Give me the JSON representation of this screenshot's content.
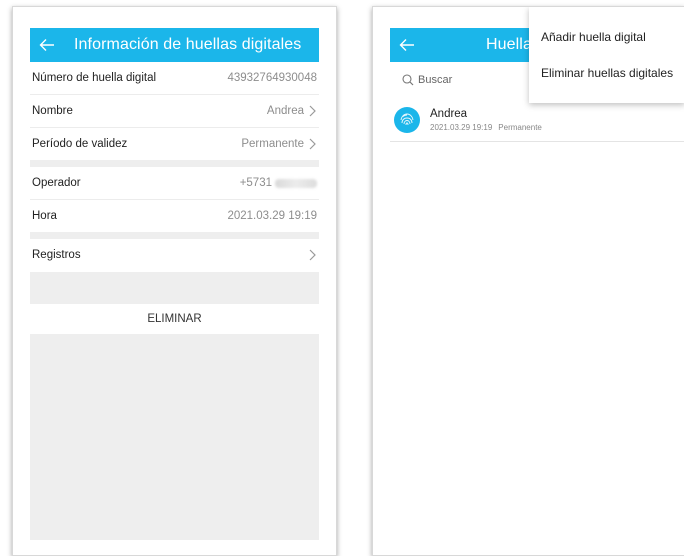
{
  "left": {
    "title": "Información de huellas digitales",
    "rows": [
      {
        "label": "Número de huella digital",
        "value": "43932764930048"
      },
      {
        "label": "Nombre",
        "value": "Andrea"
      },
      {
        "label": "Período de validez",
        "value": "Permanente"
      },
      {
        "label": "Operador",
        "value": "+5731"
      },
      {
        "label": "Hora",
        "value": "2021.03.29 19:19"
      },
      {
        "label": "Registros",
        "value": ""
      }
    ],
    "delete_label": "ELIMINAR"
  },
  "right": {
    "title": "Huella",
    "search_placeholder": "Buscar",
    "menu": [
      "Añadir huella digital",
      "Eliminar huellas digitales"
    ],
    "item": {
      "name": "Andrea",
      "date": "2021.03.29 19:19",
      "validity": "Permanente"
    }
  },
  "colors": {
    "accent": "#1bb6ea",
    "section_bg": "#eeeeee"
  }
}
